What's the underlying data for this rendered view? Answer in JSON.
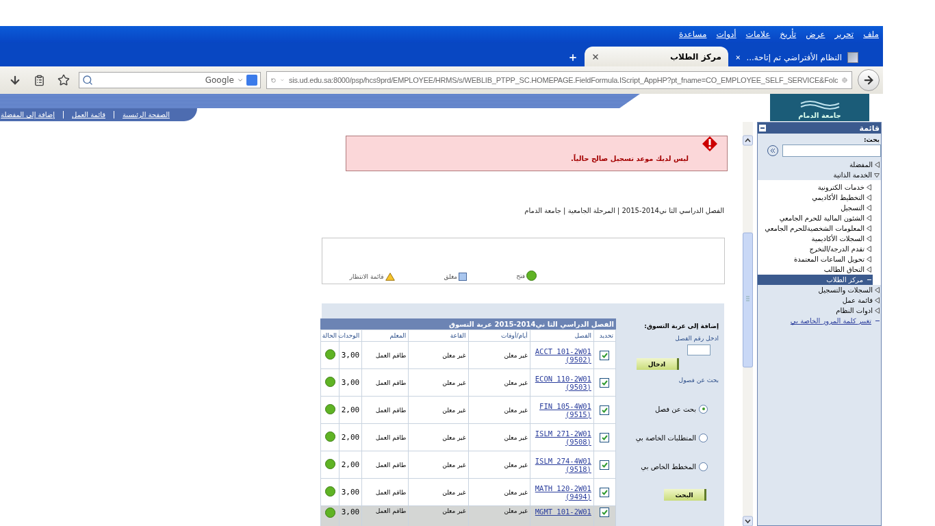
{
  "browser": {
    "menu": [
      "ملف",
      "تحرير",
      "عرض",
      "تأريخ",
      "علامات",
      "أدوات",
      "مساعدة"
    ],
    "tabs": [
      {
        "title": "النظام الأفتراضي تم إتاحة...",
        "selected": false
      },
      {
        "title": "مركز الطلاب",
        "selected": true
      }
    ],
    "address": "sis.ud.edu.sa:8000/psp/hcs9prd/EMPLOYEE/HRMS/s/WEBLIB_PTPP_SC.HOMEPAGE.FieldFormula.IScript_AppHP?pt_fname=CO_EMPLOYEE_SELF_SERVICE&Folc",
    "search_engine": "Google"
  },
  "header": {
    "logo_text": "جامعة الدمام",
    "links": [
      "الصفحة الرئيسية",
      "قائمة العمل",
      "إضافة إلى المفضلة"
    ]
  },
  "sidebar": {
    "title": "قائمة",
    "search_label": "بحث:",
    "items": [
      {
        "label": "المفضلة",
        "expanded": false,
        "selected": false
      },
      {
        "label": "الخدمة الذاتية",
        "expanded": true,
        "selected": false,
        "children": [
          {
            "label": "خدمات الكترونية",
            "kind": "folder",
            "selected": false
          },
          {
            "label": "التخطيط الأكاديمي",
            "kind": "folder",
            "selected": false
          },
          {
            "label": "التسجيل",
            "kind": "folder",
            "selected": false
          },
          {
            "label": "الشئون المالية للحرم الجامعي",
            "kind": "folder",
            "selected": false
          },
          {
            "label": "المعلومات الشخصيةللحرم الجامعي",
            "kind": "folder",
            "selected": false
          },
          {
            "label": "السجلات الأكاديمية",
            "kind": "folder",
            "selected": false
          },
          {
            "label": "تقدم الدرجة/التخرج",
            "kind": "folder",
            "selected": false
          },
          {
            "label": "تحويل الساعات المعتمدة",
            "kind": "folder",
            "selected": false
          },
          {
            "label": "التحاق الطالب",
            "kind": "folder",
            "selected": false
          },
          {
            "label": "مركز الطلاب",
            "kind": "page",
            "selected": true
          }
        ]
      },
      {
        "label": "السجلات والتسجيل",
        "expanded": false,
        "selected": false
      },
      {
        "label": "قائمة عمل",
        "expanded": false,
        "selected": false
      },
      {
        "label": "ادوات النظام",
        "expanded": false,
        "selected": false
      }
    ],
    "password_link": "تغيير كلمة المرور الخاصة بي"
  },
  "message": "ليس لديك موعد تسجيل صالح حالياً.",
  "breadcrumb": "الفصل الدراسي الثا ني2014-2015 | المرحلة الجامعية | جامعة الدمام",
  "legend": [
    {
      "kind": "open",
      "label": "فتح"
    },
    {
      "kind": "closed",
      "label": "مغلق"
    },
    {
      "kind": "waitlist",
      "label": "قائمة الانتظار"
    }
  ],
  "add_form": {
    "title": "إضافة إلى عربة التسوق:",
    "class_number_label": "ادخل رقم الفصل",
    "enter_button": "ادخال",
    "search_title": "بحث عن فصول",
    "options": [
      {
        "label": "بحث عن فصل",
        "selected": true
      },
      {
        "label": "المتطلبات الخاصة بي",
        "selected": false
      },
      {
        "label": "المخطط الخاص بي",
        "selected": false
      }
    ],
    "search_button": "البحث"
  },
  "cart": {
    "title": "الفصل الدراسي الثا ني2014-2015 عربة التسوق",
    "columns": [
      "تحديد",
      "الفصل",
      "أيام/أوقات",
      "القاعة",
      "المعلم",
      "الوحدات",
      "الحالة"
    ],
    "rows": [
      {
        "checked": true,
        "class": "ACCT 101-2W01 (9502)",
        "days_times": "غير معلن",
        "room": "غير معلن",
        "instructor": "طاقم العمل",
        "units": "3,00",
        "kind": "open",
        "highlighted": false
      },
      {
        "checked": true,
        "class": "ECON 110-2W01 (9503)",
        "days_times": "غير معلن",
        "room": "غير معلن",
        "instructor": "طاقم العمل",
        "units": "3,00",
        "kind": "open",
        "highlighted": false
      },
      {
        "checked": true,
        "class": "FIN 105-4W01 (9515)",
        "days_times": "غير معلن",
        "room": "غير معلن",
        "instructor": "طاقم العمل",
        "units": "2,00",
        "kind": "open",
        "highlighted": false
      },
      {
        "checked": true,
        "class": "ISLM 271-2W01 (9508)",
        "days_times": "غير معلن",
        "room": "غير معلن",
        "instructor": "طاقم العمل",
        "units": "2,00",
        "kind": "open",
        "highlighted": false
      },
      {
        "checked": true,
        "class": "ISLM 274-4W01 (9518)",
        "days_times": "غير معلن",
        "room": "غير معلن",
        "instructor": "طاقم العمل",
        "units": "2,00",
        "kind": "open",
        "highlighted": false
      },
      {
        "checked": true,
        "class": "MATH 120-2W01 (9494)",
        "days_times": "غير معلن",
        "room": "غير معلن",
        "instructor": "طاقم العمل",
        "units": "3,00",
        "kind": "open",
        "highlighted": false
      },
      {
        "checked": true,
        "class": "MGMT 101-2W01",
        "days_times": "غير معلن",
        "room": "غير معلن",
        "instructor": "طاقم العمل",
        "units": "3,00",
        "kind": "open",
        "highlighted": true
      }
    ]
  }
}
